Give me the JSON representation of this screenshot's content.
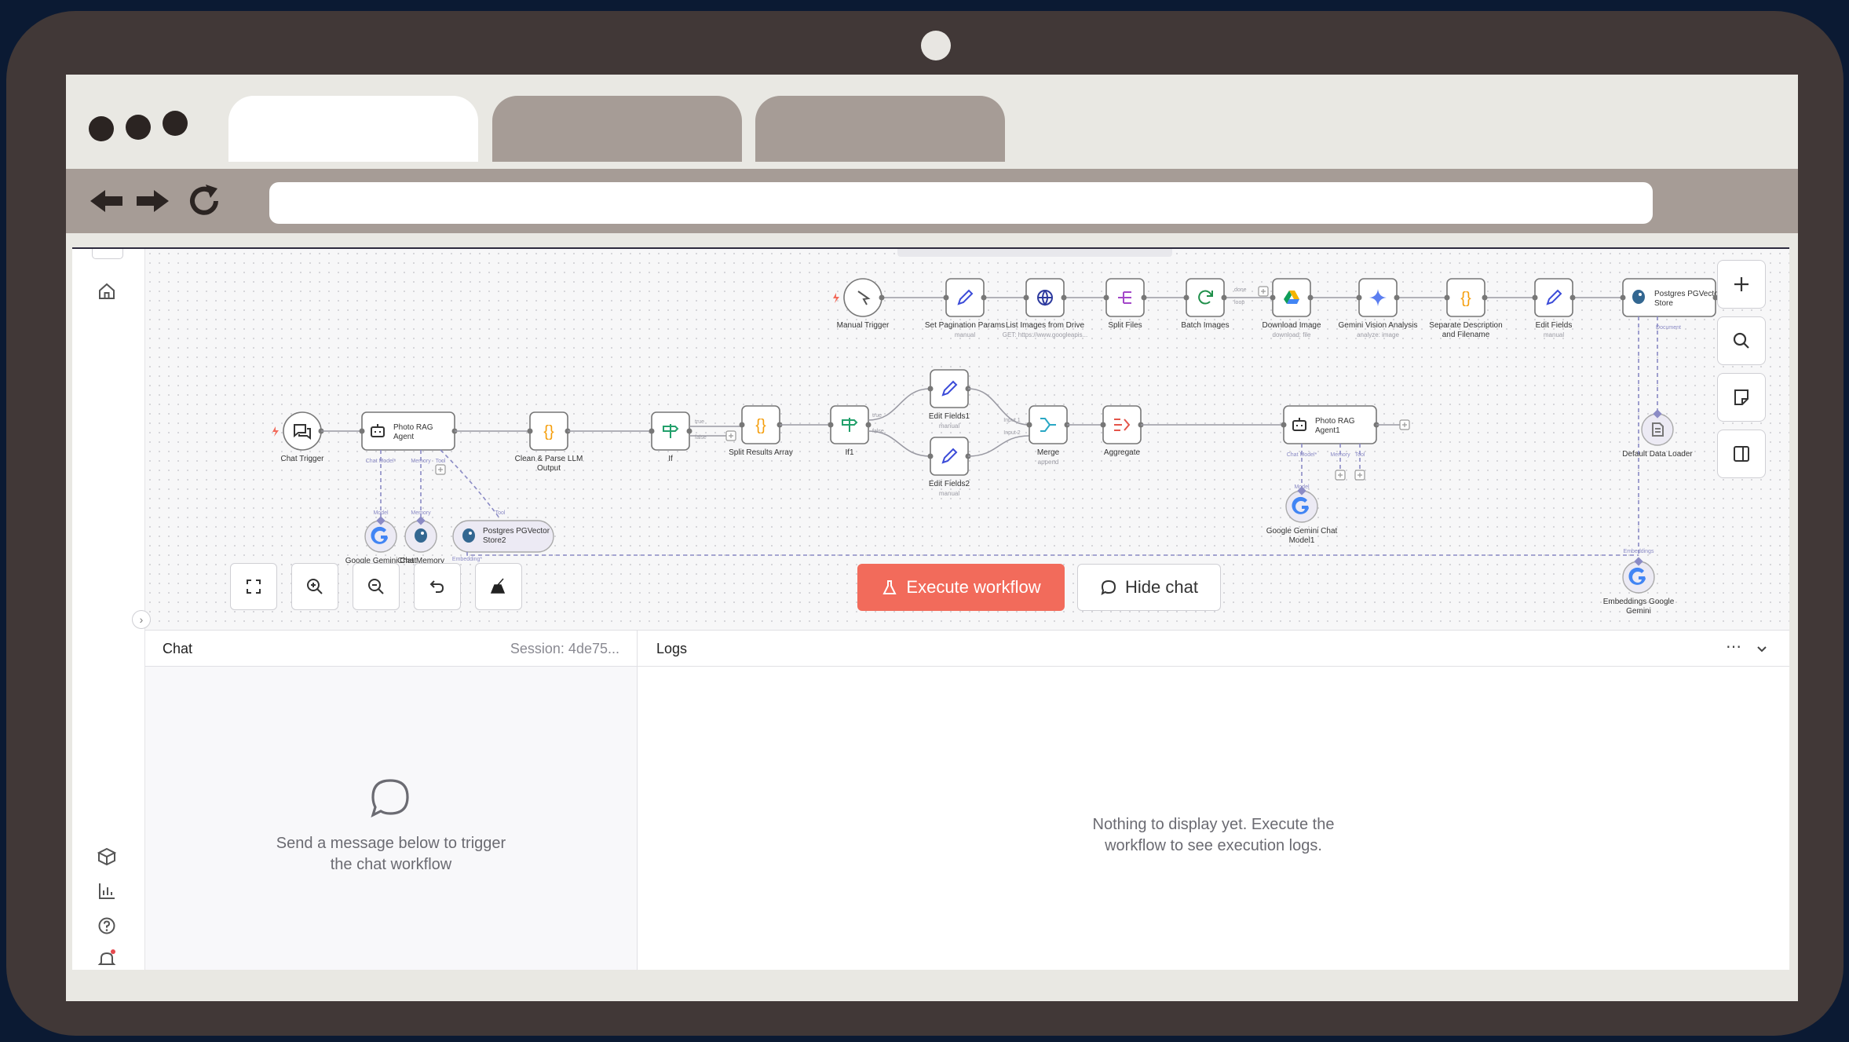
{
  "canvas": {
    "nodes": [
      {
        "label": "Manual Trigger",
        "sub": ""
      },
      {
        "label": "Set Pagination Params",
        "sub": "manual"
      },
      {
        "label": "List Images from Drive",
        "sub": "GET: https://www.googleapis..."
      },
      {
        "label": "Split Files",
        "sub": ""
      },
      {
        "label": "Batch Images",
        "sub": ""
      },
      {
        "label": "Download Image",
        "sub": "download: file"
      },
      {
        "label": "Gemini Vision Analysis",
        "sub": "analyze: image"
      },
      {
        "label": "Separate Description and Filename",
        "sub": ""
      },
      {
        "label": "Edit Fields",
        "sub": "manual"
      },
      {
        "label": "Postgres PGVector Store",
        "sub": ""
      },
      {
        "label": "Default Data Loader",
        "sub": ""
      },
      {
        "label": "Embeddings Google Gemini",
        "sub": ""
      },
      {
        "label": "Chat Trigger",
        "sub": ""
      },
      {
        "label": "Photo RAG Agent",
        "sub": ""
      },
      {
        "label": "Clean & Parse LLM Output",
        "sub": ""
      },
      {
        "label": "If",
        "sub": ""
      },
      {
        "label": "Split Results Array",
        "sub": ""
      },
      {
        "label": "If1",
        "sub": ""
      },
      {
        "label": "Edit Fields1",
        "sub": "manual"
      },
      {
        "label": "Edit Fields2",
        "sub": "manual"
      },
      {
        "label": "Merge",
        "sub": "append"
      },
      {
        "label": "Aggregate",
        "sub": ""
      },
      {
        "label": "Photo RAG Agent1",
        "sub": ""
      },
      {
        "label": "Google Gemini Chat Model1",
        "sub": ""
      },
      {
        "label": "Google Gemini Chat Model",
        "sub": ""
      },
      {
        "label": "Chat Memory",
        "sub": ""
      },
      {
        "label": "Postgres PGVector Store2",
        "sub": ""
      }
    ],
    "port_labels": {
      "chat_model": "Chat Model*",
      "memory": "Memory",
      "tool": "Tool",
      "model": "Model",
      "document": "Document",
      "embedding": "Embedding*",
      "embeddings": "Embeddings",
      "true": "true",
      "false": "false",
      "input1": "Input 1",
      "input2": "Input 2",
      "done": "done",
      "loop": "loop"
    },
    "icons": {
      "manual_trigger": "cursor-icon",
      "edit": "pencil-icon",
      "http": "globe-icon",
      "split": "split-icon",
      "batch": "loop-icon",
      "drive": "google-drive-icon",
      "gemini": "gemini-icon",
      "code": "braces-icon",
      "postgres": "postgres-icon",
      "chat": "chat-icon",
      "agent": "robot-icon",
      "if": "signpost-icon",
      "merge": "merge-icon",
      "aggregate": "aggregate-icon",
      "google": "google-icon",
      "loader": "document-icon"
    },
    "colors": {
      "wire": "#9a9aa3",
      "dashed": "#8b8bc5",
      "trigger": "#f26b5b",
      "code": "#f59e0b",
      "edit": "#3b4bd8",
      "if": "#22a06b",
      "merge": "#29a7c4",
      "aggregate": "#e4554a"
    }
  },
  "controls": {
    "execute_label": "Execute workflow",
    "hide_chat_label": "Hide chat"
  },
  "chat": {
    "title": "Chat",
    "session": "Session: 4de75...",
    "empty_line1": "Send a message below to trigger",
    "empty_line2": "the chat workflow"
  },
  "logs": {
    "title": "Logs",
    "empty_line1": "Nothing to display yet. Execute the",
    "empty_line2": "workflow to see execution logs."
  }
}
